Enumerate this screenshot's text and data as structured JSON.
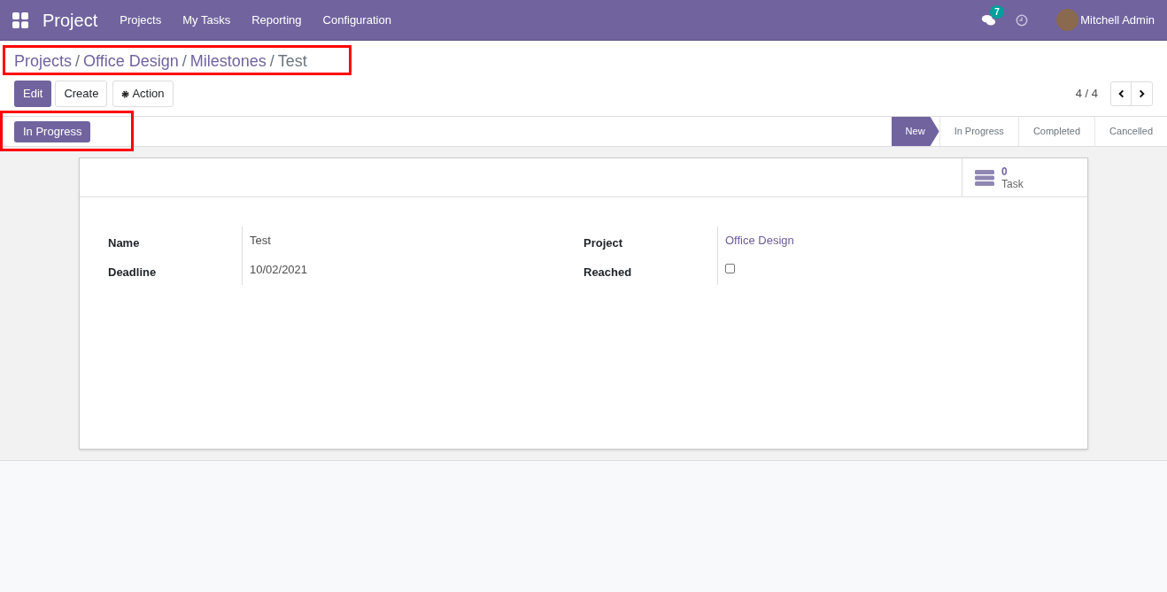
{
  "navbar": {
    "app_title": "Project",
    "menu": [
      "Projects",
      "My Tasks",
      "Reporting",
      "Configuration"
    ],
    "messages_badge": "7",
    "user": "Mitchell Admin"
  },
  "breadcrumb": {
    "highlighted": true,
    "links": [
      "Projects",
      "Office Design",
      "Milestones"
    ],
    "separator": "/",
    "current": "Test"
  },
  "buttons": {
    "edit": "Edit",
    "create": "Create",
    "action": "Action"
  },
  "pager": "4 / 4",
  "statusbar": {
    "button": {
      "label": "In Progress",
      "highlighted": true
    },
    "stages": [
      {
        "label": "New",
        "selected": true
      },
      {
        "label": "In Progress",
        "selected": false
      },
      {
        "label": "Completed",
        "selected": false
      },
      {
        "label": "Cancelled",
        "selected": false
      }
    ]
  },
  "smart_button": {
    "count": "0",
    "label": "Task"
  },
  "fields_left": [
    {
      "label": "Name",
      "value": "Test",
      "kind": "text"
    },
    {
      "label": "Deadline",
      "value": "10/02/2021",
      "kind": "text"
    }
  ],
  "fields_right": [
    {
      "label": "Project",
      "value": "Office Design",
      "kind": "link"
    },
    {
      "label": "Reached",
      "checked": false,
      "kind": "checkbox"
    }
  ]
}
